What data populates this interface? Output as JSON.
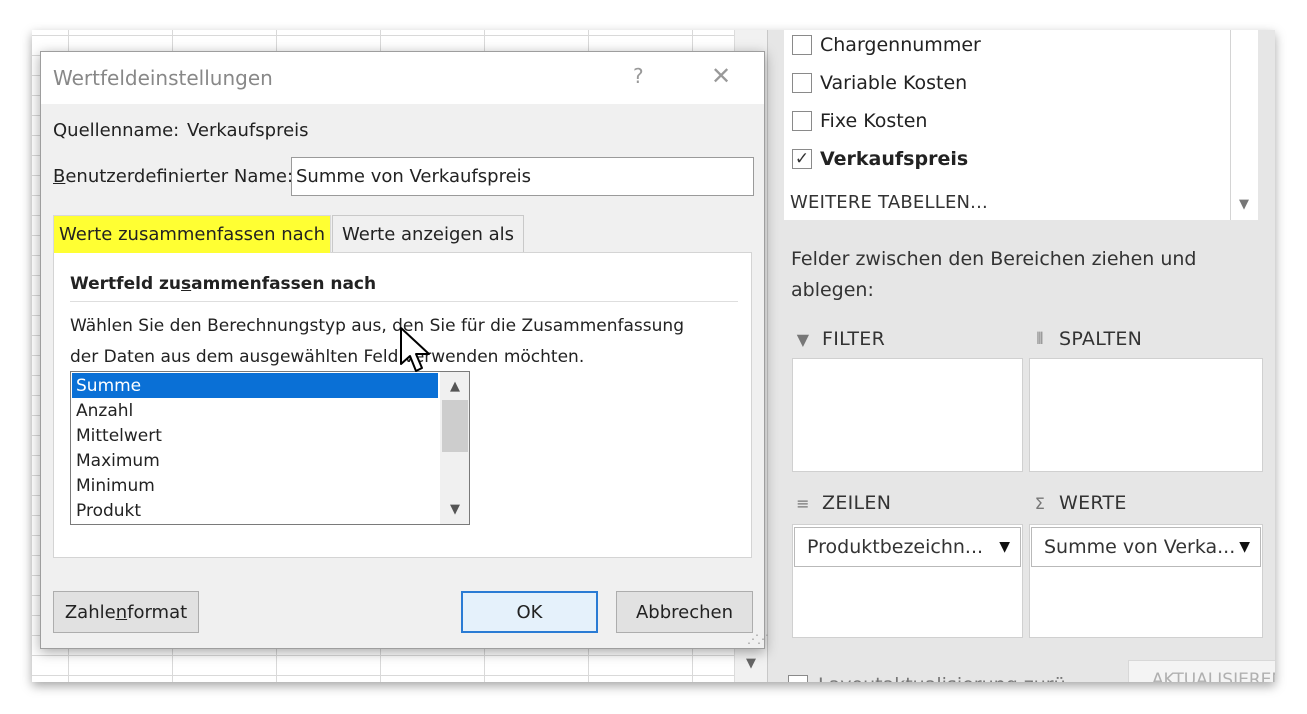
{
  "sheet": {},
  "field_list": {
    "items": [
      {
        "label": "Chargennummer",
        "checked": false
      },
      {
        "label": "Variable Kosten",
        "checked": false
      },
      {
        "label": "Fixe Kosten",
        "checked": false
      },
      {
        "label": "Verkaufspreis",
        "checked": true
      }
    ],
    "more_tables": "WEITERE TABELLEN..."
  },
  "areas": {
    "instruction": "Felder zwischen den Bereichen ziehen und ablegen:",
    "filter_label": "FILTER",
    "columns_label": "SPALTEN",
    "rows_label": "ZEILEN",
    "values_label": "WERTE",
    "rows_chip": "Produktbezeichn...",
    "values_chip": "Summe von Verka...",
    "defer_update": "Layoutaktualisierung zurü...",
    "update_button": "AKTUALISIEREN"
  },
  "dialog": {
    "title": "Wertfeldeinstellungen",
    "help": "?",
    "close": "✕",
    "source_label": "Quellenname:",
    "source_value": "Verkaufspreis",
    "custom_name_label_first": "B",
    "custom_name_label_rest": "enutzerdefinierter Name:",
    "custom_name_value": "Summe von Verkaufspreis",
    "tabs": {
      "summarize": "Werte zusammenfassen nach",
      "show_as": "Werte anzeigen als"
    },
    "group_title_a": "Wertfeld zu",
    "group_title_u": "s",
    "group_title_b": "ammenfassen nach",
    "description_line1": "Wählen Sie den Berechnungstyp aus, den Sie für die Zusammenfassung",
    "description_line2": "der Daten aus dem ausgewählten Feld verwenden möchten.",
    "list": [
      "Summe",
      "Anzahl",
      "Mittelwert",
      "Maximum",
      "Minimum",
      "Produkt"
    ],
    "selected_index": 0,
    "buttons": {
      "format_a": "Zahle",
      "format_u": "n",
      "format_b": "format",
      "ok": "OK",
      "cancel": "Abbrechen"
    }
  },
  "colors": {
    "selection": "#0a70d6",
    "tab_highlight": "#ffff33",
    "ok_border": "#2a7bd4"
  }
}
